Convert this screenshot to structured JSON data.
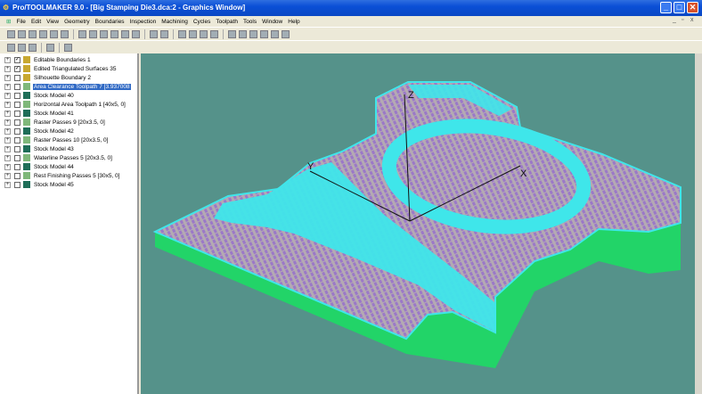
{
  "window": {
    "title": "Pro/TOOLMAKER 9.0 - [Big Stamping Die3.dca:2 - Graphics Window]",
    "minimize": "_",
    "maximize": "□",
    "close": "✕"
  },
  "menu": [
    "File",
    "Edit",
    "View",
    "Geometry",
    "Boundaries",
    "Inspection",
    "Machining",
    "Cycles",
    "Toolpath",
    "Tools",
    "Window",
    "Help"
  ],
  "tree": [
    {
      "label": "Editable Boundaries 1",
      "checked": true,
      "icon": "boundary-icon"
    },
    {
      "label": "Edited Triangulated Surfaces 35",
      "checked": true,
      "icon": "surface-icon"
    },
    {
      "label": "Silhouette Boundary 2",
      "checked": false,
      "icon": "boundary-icon"
    },
    {
      "label": "Area Clearance Toolpath 7 [3.937008",
      "checked": false,
      "icon": "toolpath-icon",
      "selected": true
    },
    {
      "label": "Stock Model 40",
      "checked": false,
      "icon": "stock-icon"
    },
    {
      "label": "Horizontal Area Toolpath 1 [40x5, 0]",
      "checked": false,
      "icon": "toolpath-icon"
    },
    {
      "label": "Stock Model 41",
      "checked": false,
      "icon": "stock-icon"
    },
    {
      "label": "Raster Passes 9 [20x3.5, 0]",
      "checked": false,
      "icon": "toolpath-icon"
    },
    {
      "label": "Stock Model 42",
      "checked": false,
      "icon": "stock-icon"
    },
    {
      "label": "Raster Passes 10 [20x3.5, 0]",
      "checked": false,
      "icon": "toolpath-icon"
    },
    {
      "label": "Stock Model 43",
      "checked": false,
      "icon": "stock-icon"
    },
    {
      "label": "Waterline Passes 5 [20x3.5, 0]",
      "checked": false,
      "icon": "toolpath-icon"
    },
    {
      "label": "Stock Model 44",
      "checked": false,
      "icon": "stock-icon"
    },
    {
      "label": "Rest Finishing Passes 5 [30x5, 0]",
      "checked": false,
      "icon": "toolpath-icon"
    },
    {
      "label": "Stock Model 45",
      "checked": false,
      "icon": "stock-icon"
    }
  ],
  "axes": {
    "x": "X",
    "y": "Y",
    "z": "Z"
  },
  "colors": {
    "background": "#55928a",
    "stock_side": "#22d468",
    "cyan": "#3fe6ea",
    "purple": "#9a7ac8",
    "grey": "#b0a8b0"
  }
}
